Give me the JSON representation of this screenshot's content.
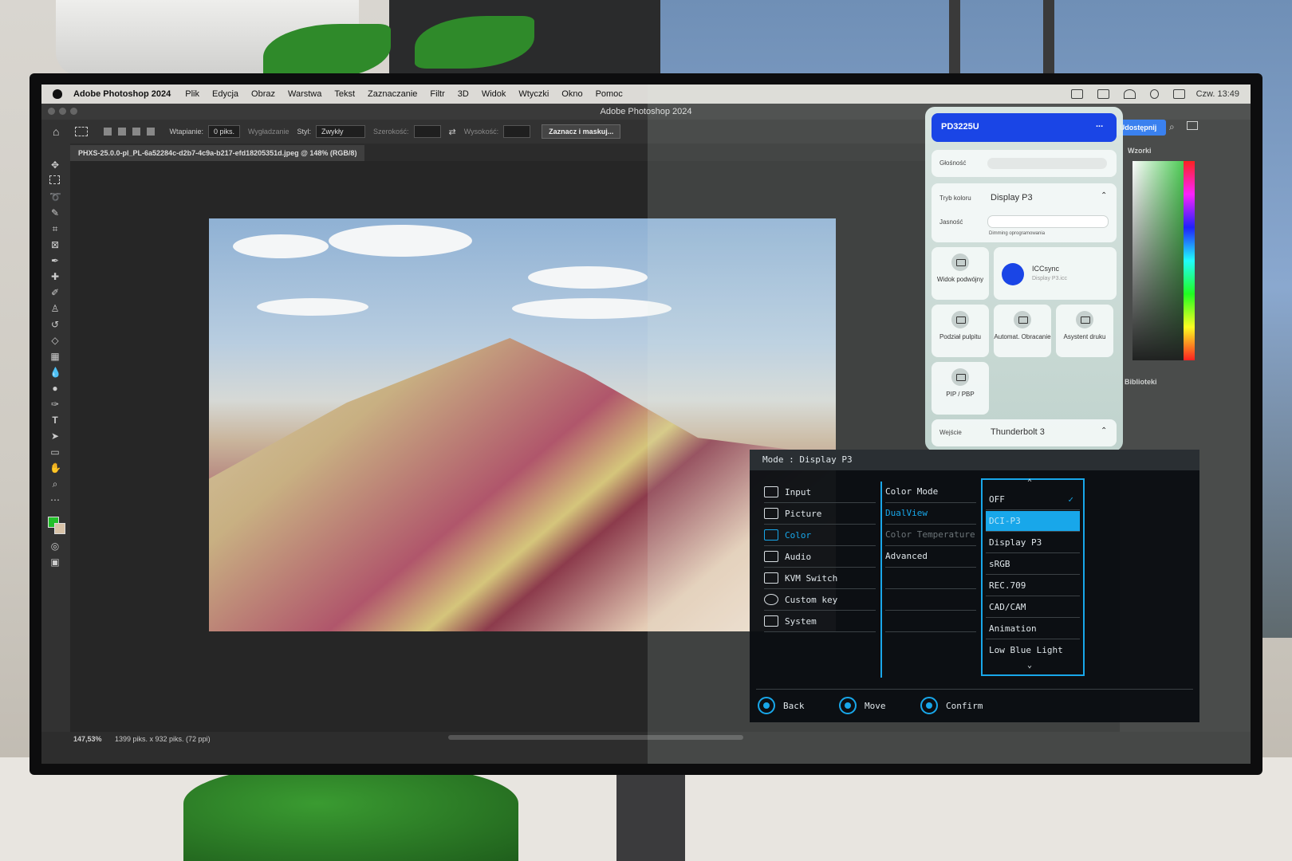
{
  "menubar": {
    "app": "Adobe Photoshop 2024",
    "items": [
      "Plik",
      "Edycja",
      "Obraz",
      "Warstwa",
      "Tekst",
      "Zaznaczanie",
      "Filtr",
      "3D",
      "Widok",
      "Wtyczki",
      "Okno",
      "Pomoc"
    ],
    "clock": "Czw. 13:49"
  },
  "window_title": "Adobe Photoshop 2024",
  "options": {
    "feather_label": "Wtapianie:",
    "feather_value": "0 piks.",
    "antialias_label": "Wygładzanie",
    "style_label": "Styl:",
    "style_value": "Zwykły",
    "width_label": "Szerokość:",
    "height_label": "Wysokość:",
    "mask_button": "Zaznacz i maskuj...",
    "share_button": "Udostępnij"
  },
  "document_tab": "PHXS-25.0.0-pl_PL-6a52284c-d2b7-4c9a-b217-efd18205351d.jpeg @ 148% (RGB/8)",
  "status": {
    "zoom": "147,53%",
    "size": "1399 piks. x 932 piks. (72 ppi)"
  },
  "panels": {
    "patterns_tab": "Wzorki",
    "libraries_tab": "Biblioteki"
  },
  "display_pilot": {
    "model": "PD3225U",
    "more": "...",
    "volume_label": "Głośność",
    "color_mode_label": "Tryb koloru",
    "color_mode_value": "Display P3",
    "brightness_label": "Jasność",
    "dimming_label": "Dimming oprogramowania",
    "tiles": {
      "dual_view": "Widok podwójny",
      "icc_title": "ICCsync",
      "icc_sub": "Display P3.icc",
      "split": "Podział pulpitu",
      "auto_rotate": "Automat. Obracanie",
      "print_assist": "Asystent druku",
      "pip": "PIP / PBP"
    },
    "input_label": "Wejście",
    "input_value": "Thunderbolt 3"
  },
  "osd": {
    "header": "Mode : Display P3",
    "main_menu": [
      "Input",
      "Picture",
      "Color",
      "Audio",
      "KVM Switch",
      "Custom key",
      "System"
    ],
    "sub_menu": [
      "Color Mode",
      "DualView",
      "Color Temperature",
      "Advanced"
    ],
    "options": [
      "OFF",
      "DCI-P3",
      "Display P3",
      "sRGB",
      "REC.709",
      "CAD/CAM",
      "Animation",
      "Low Blue Light"
    ],
    "selected_option": "DCI-P3",
    "nav": {
      "back": "Back",
      "move": "Move",
      "confirm": "Confirm"
    }
  },
  "colors": {
    "osd_accent": "#18a7ea",
    "pilot_header": "#1a45e6"
  }
}
